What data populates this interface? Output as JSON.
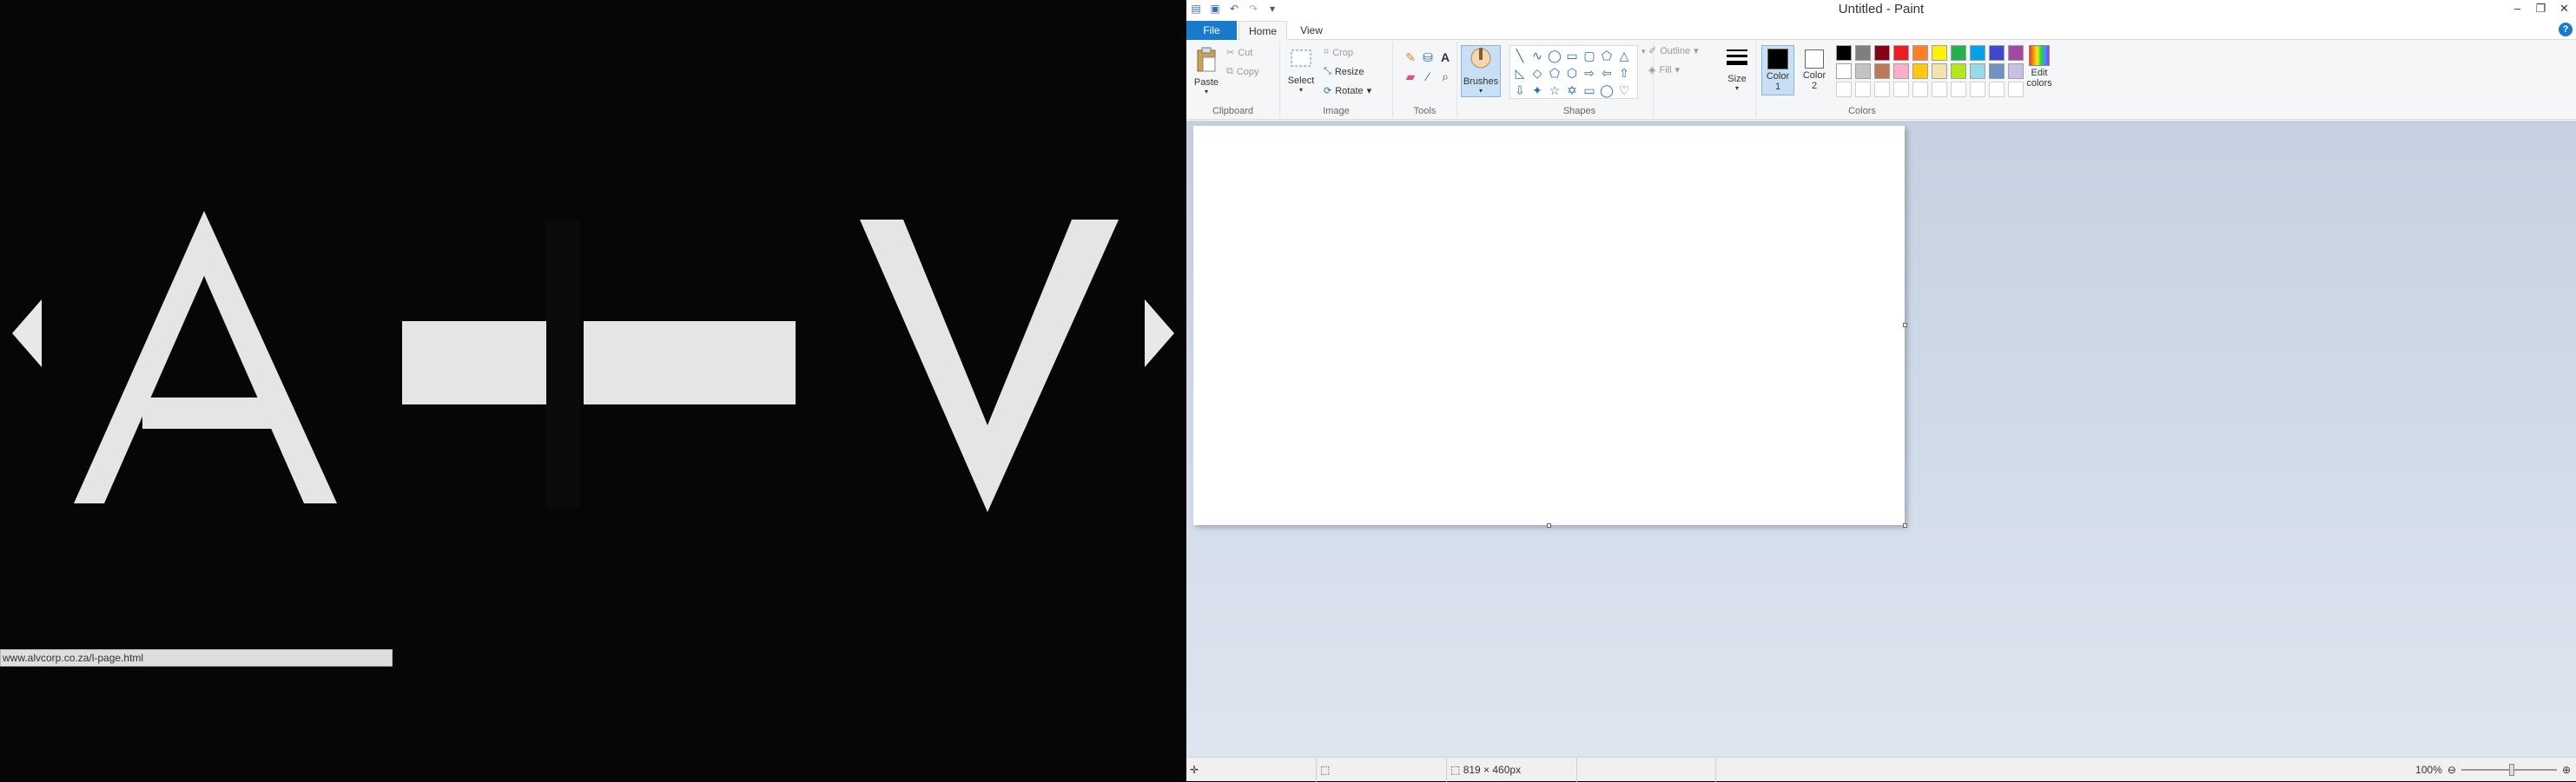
{
  "browser": {
    "logo_letters": [
      "A",
      "V"
    ],
    "status_url": "www.alvcorp.co.za/l-page.html"
  },
  "paint": {
    "window_title": "Untitled - Paint",
    "window_controls": [
      "–",
      "❐",
      "✕"
    ],
    "tabs": {
      "file": "File",
      "home": "Home",
      "view": "View"
    },
    "clipboard": {
      "paste": "Paste",
      "cut": "Cut",
      "copy": "Copy",
      "label": "Clipboard"
    },
    "image": {
      "select": "Select",
      "crop": "Crop",
      "resize": "Resize",
      "rotate": "Rotate",
      "label": "Image"
    },
    "tools": {
      "label": "Tools"
    },
    "brushes": {
      "label": "Brushes"
    },
    "shapes": {
      "outline": "Outline",
      "fill": "Fill",
      "label": "Shapes"
    },
    "size": {
      "label": "Size"
    },
    "colors": {
      "color1_label": "Color 1",
      "color2_label": "Color 2",
      "edit_label": "Edit colors",
      "label": "Colors",
      "color1": "#000000",
      "color2": "#ffffff",
      "palette_row1": [
        "#000000",
        "#7f7f7f",
        "#880015",
        "#ed1c24",
        "#ff7f27",
        "#fff200",
        "#22b14c",
        "#00a2e8",
        "#3f48cc",
        "#a349a4"
      ],
      "palette_row2": [
        "#ffffff",
        "#c3c3c3",
        "#b97a57",
        "#ffaec9",
        "#ffc90e",
        "#efe4b0",
        "#b5e61d",
        "#99d9ea",
        "#7092be",
        "#c8bfe7"
      ]
    },
    "status": {
      "dimensions": "819 × 460px",
      "zoom": "100%"
    }
  }
}
